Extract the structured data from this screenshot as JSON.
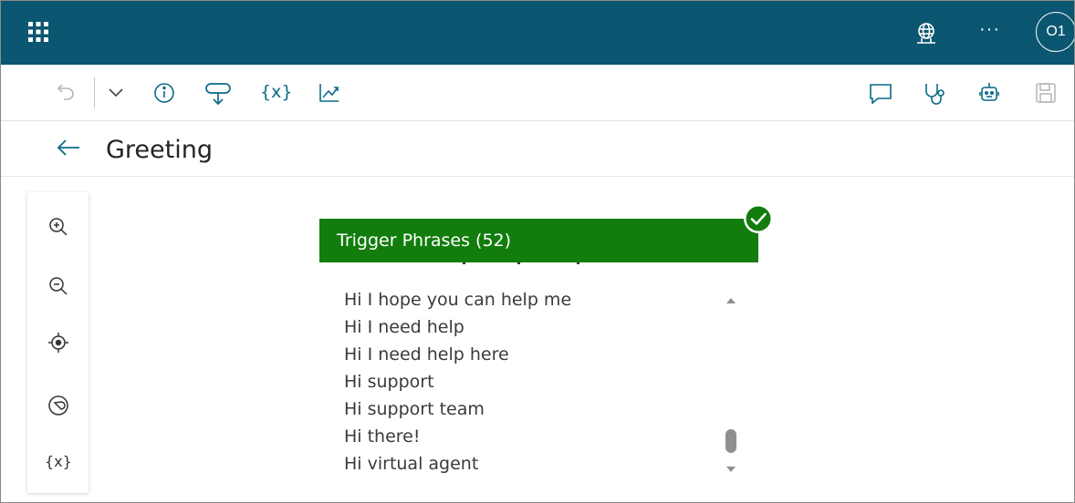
{
  "topbar": {
    "icons": [
      "app-launcher-icon",
      "environment-globe-icon",
      "more-icon"
    ],
    "more_label": "···",
    "avatar_initials": "O1",
    "bg_color": "#0b5670"
  },
  "commandbar": {
    "icons": [
      "undo-icon",
      "chevron-down-icon",
      "info-icon",
      "topic-trigger-icon",
      "variables-icon",
      "analytics-icon",
      "comment-icon",
      "topic-checker-icon",
      "bot-icon",
      "save-icon"
    ],
    "variables_label": "{x}"
  },
  "header": {
    "title": "Greeting"
  },
  "zoom_panel": {
    "icons": [
      "zoom-in-icon",
      "zoom-out-icon",
      "recenter-icon",
      "minimap-icon",
      "variables-icon"
    ],
    "variables_label": "{x}"
  },
  "trigger_node": {
    "label": "Trigger Phrases (52)",
    "color": "#127d0d",
    "phrases": [
      "Hi I hope you can help me",
      "Hi I need help",
      "Hi I need help here",
      "Hi support",
      "Hi support team",
      "Hi there!",
      "Hi virtual agent"
    ]
  }
}
